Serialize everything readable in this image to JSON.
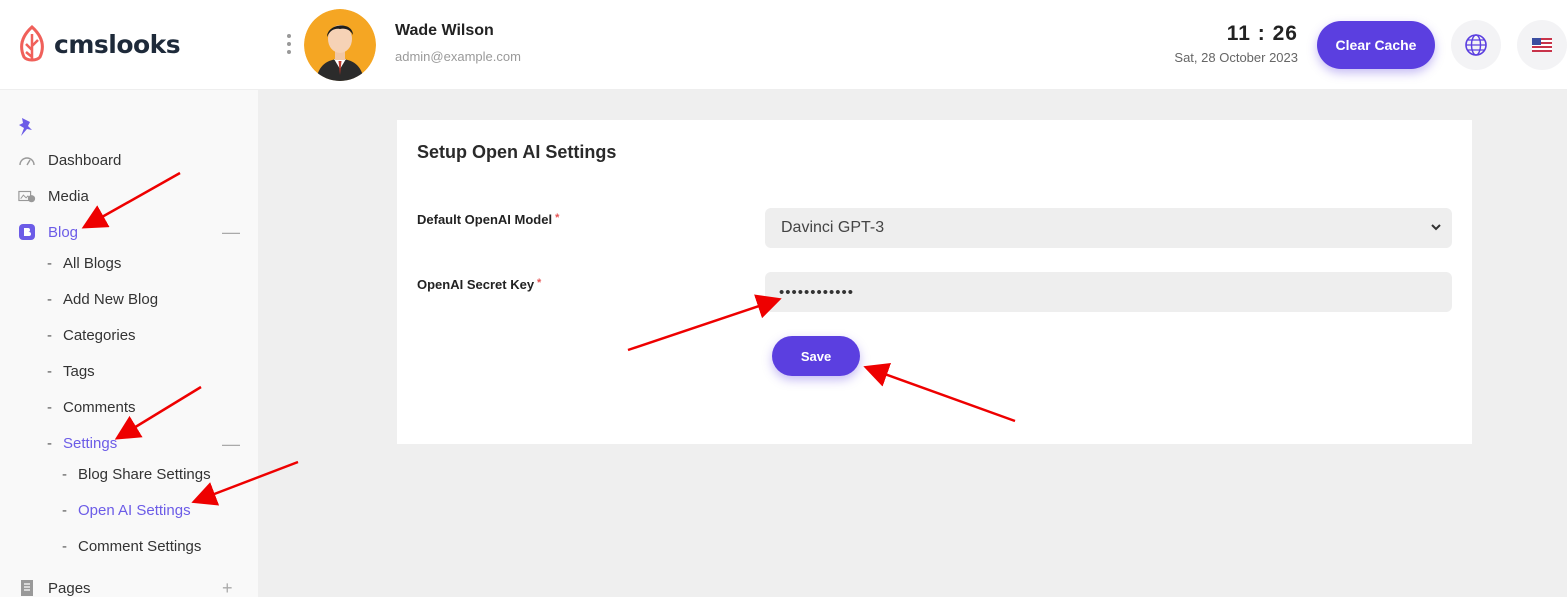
{
  "brand": {
    "logo_text": "cmslooks"
  },
  "header": {
    "user_name": "Wade Wilson",
    "user_email": "admin@example.com",
    "time": "11 : 26",
    "date": "Sat, 28 October 2023",
    "clear_cache_label": "Clear Cache",
    "accent_color": "#5b3fe0"
  },
  "sidebar": {
    "pin_icon": "pin-icon",
    "items": [
      {
        "label": "Dashboard",
        "icon": "gauge-icon"
      },
      {
        "label": "Media",
        "icon": "media-icon"
      },
      {
        "label": "Blog",
        "icon": "blog-icon",
        "toggle": "—",
        "active": true
      },
      {
        "label": "Pages",
        "icon": "pages-icon",
        "toggle": "+"
      }
    ],
    "blog_subitems": [
      "All Blogs",
      "Add New Blog",
      "Categories",
      "Tags",
      "Comments",
      "Settings"
    ],
    "settings_toggle": "—",
    "settings_subitems": [
      "Blog Share Settings",
      "Open AI Settings",
      "Comment Settings"
    ],
    "active_subitem": "Open AI Settings",
    "dash": "-"
  },
  "card": {
    "title": "Setup Open AI Settings",
    "model_label": "Default OpenAI Model",
    "model_value": "Davinci GPT-3",
    "key_label": "OpenAI Secret Key",
    "key_value": "••••••••••••",
    "required_mark": "*",
    "save_label": "Save"
  }
}
